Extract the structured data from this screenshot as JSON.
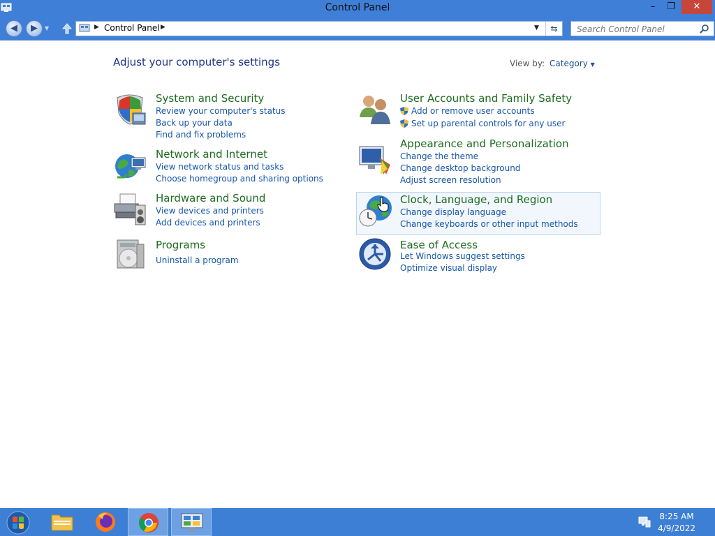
{
  "window": {
    "title": "Control Panel",
    "min": "–",
    "max": "❐",
    "close": "✕"
  },
  "address": {
    "path": "Control Panel",
    "search_placeholder": "Search Control Panel"
  },
  "page": {
    "heading": "Adjust your computer's settings",
    "view_by_label": "View by:",
    "view_by_value": "Category"
  },
  "categories": [
    {
      "title": "System and Security",
      "links": [
        "Review your computer's status",
        "Back up your data",
        "Find and fix problems"
      ]
    },
    {
      "title": "Network and Internet",
      "links": [
        "View network status and tasks",
        "Choose homegroup and sharing options"
      ]
    },
    {
      "title": "Hardware and Sound",
      "links": [
        "View devices and printers",
        "Add devices and printers"
      ]
    },
    {
      "title": "Programs",
      "links": [
        "Uninstall a program"
      ]
    },
    {
      "title": "User Accounts and Family Safety",
      "links": [
        "Add or remove user accounts",
        "Set up parental controls for any user"
      ]
    },
    {
      "title": "Appearance and Personalization",
      "links": [
        "Change the theme",
        "Change desktop background",
        "Adjust screen resolution"
      ]
    },
    {
      "title": "Clock, Language, and Region",
      "links": [
        "Change display language",
        "Change keyboards or other input methods"
      ]
    },
    {
      "title": "Ease of Access",
      "links": [
        "Let Windows suggest settings",
        "Optimize visual display"
      ]
    }
  ],
  "taskbar": {
    "time": "8:25 AM",
    "date": "4/9/2022"
  },
  "colors": {
    "accent": "#3f7fd7",
    "category_title": "#1d6b1f",
    "link": "#1756a9",
    "close": "#c7463a"
  }
}
